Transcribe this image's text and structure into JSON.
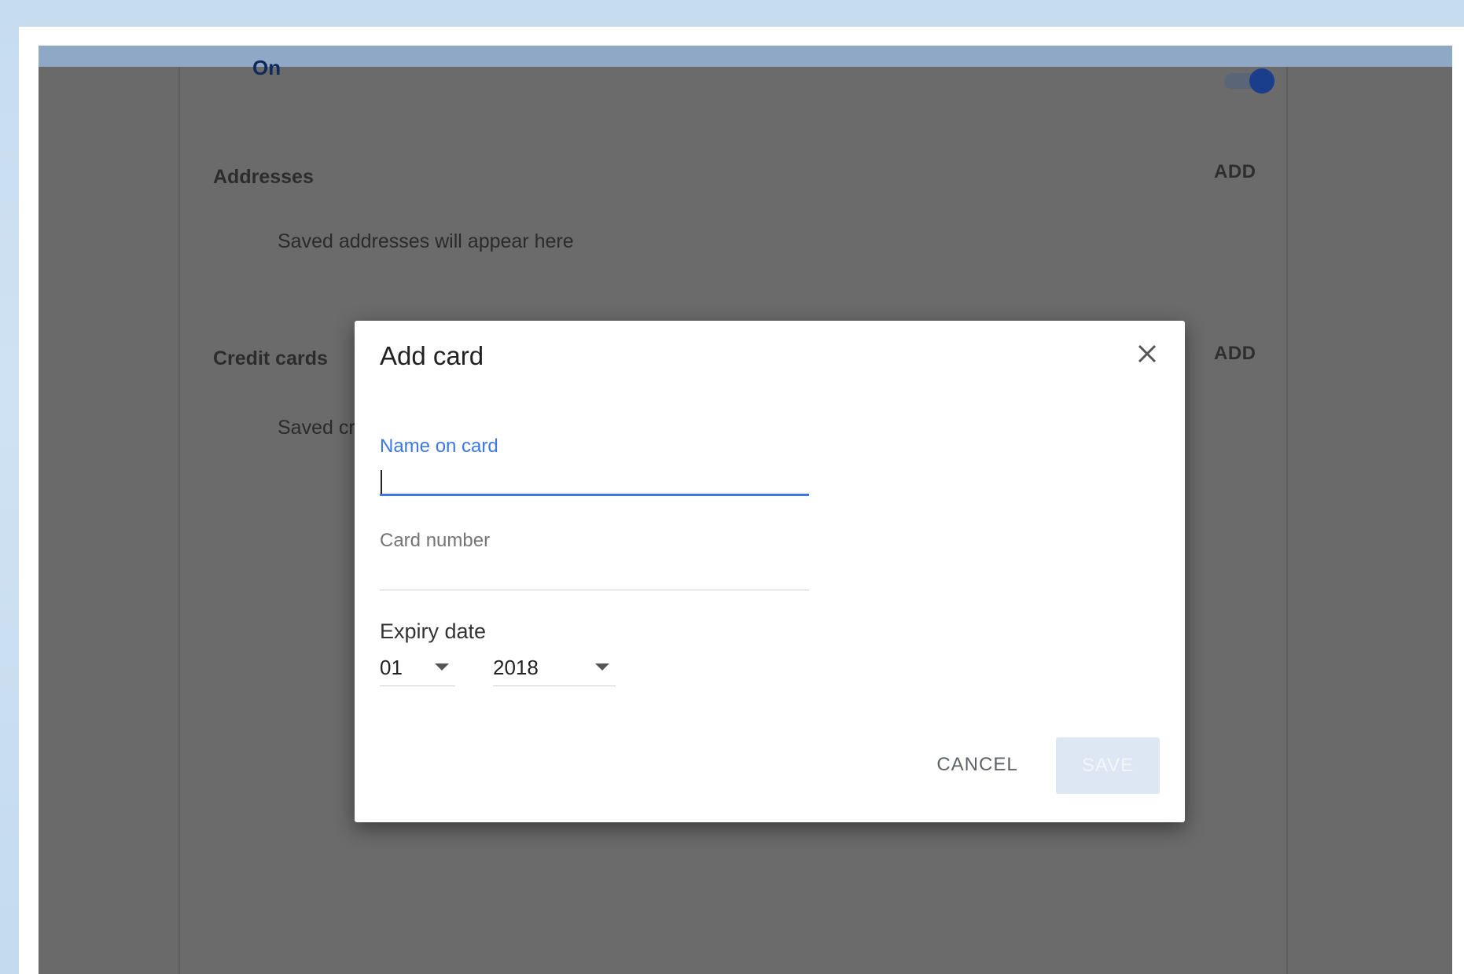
{
  "settings": {
    "toggle_state_label": "On",
    "autofill_enabled": true,
    "addresses": {
      "title": "Addresses",
      "add_label": "ADD",
      "empty_text": "Saved addresses will appear here"
    },
    "credit_cards": {
      "title": "Credit cards",
      "add_label": "ADD",
      "empty_text": "Saved credit cards will appear here"
    }
  },
  "dialog": {
    "title": "Add card",
    "close_icon": "close-icon",
    "name_field": {
      "label": "Name on card",
      "value": ""
    },
    "card_number_field": {
      "label": "Card number",
      "value": ""
    },
    "expiry": {
      "label": "Expiry date",
      "month": "01",
      "year": "2018"
    },
    "cancel_label": "CANCEL",
    "save_label": "SAVE"
  },
  "colors": {
    "accent": "#3b78e7",
    "overlay": "#6b6a6a",
    "save_disabled_bg": "#dde7f4"
  }
}
